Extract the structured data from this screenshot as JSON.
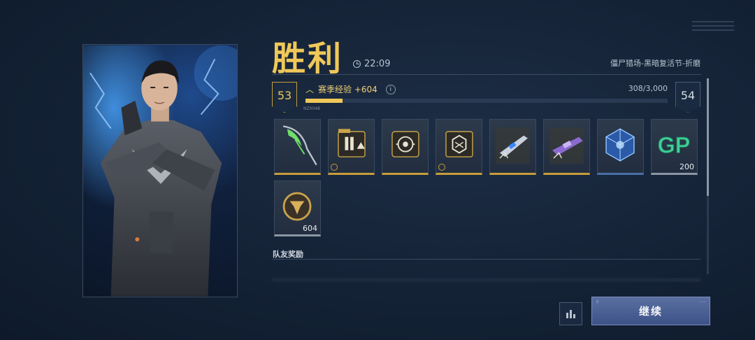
{
  "header": {
    "title": "胜利",
    "time": "22:09",
    "mode": "僵尸猎场-黑暗复活节-折磨"
  },
  "level": {
    "current": "53",
    "next": "54",
    "xp_label": "赛季经验 +604",
    "xp_progress": "308/3,000",
    "progress_fraction": 0.1027,
    "rank_tag": "NZ0048"
  },
  "rewards": [
    {
      "icon": "scythe-icon",
      "count": "",
      "rarity": "gold"
    },
    {
      "icon": "folder-weapon-icon",
      "count": "",
      "rarity": "gold"
    },
    {
      "icon": "target-module-icon",
      "count": "",
      "rarity": "gold"
    },
    {
      "icon": "crate-badge-icon",
      "count": "",
      "rarity": "gold"
    },
    {
      "icon": "rifle-blueprint-icon",
      "count": "",
      "rarity": "gold"
    },
    {
      "icon": "smg-blueprint-icon",
      "count": "",
      "rarity": "gold"
    },
    {
      "icon": "cube-core-icon",
      "count": "",
      "rarity": "blue"
    },
    {
      "icon": "gp-currency-icon",
      "count": "200",
      "rarity": "gray"
    },
    {
      "icon": "season-token-icon",
      "count": "604",
      "rarity": "gray"
    }
  ],
  "teammate_section": {
    "label": "队友奖励"
  },
  "buttons": {
    "continue": "继续",
    "continue_deco_left": "//",
    "continue_deco_right": "- - -"
  },
  "colors": {
    "accent_gold": "#f0c85a",
    "bg": "#142236",
    "button_blue": "#3d5288"
  }
}
